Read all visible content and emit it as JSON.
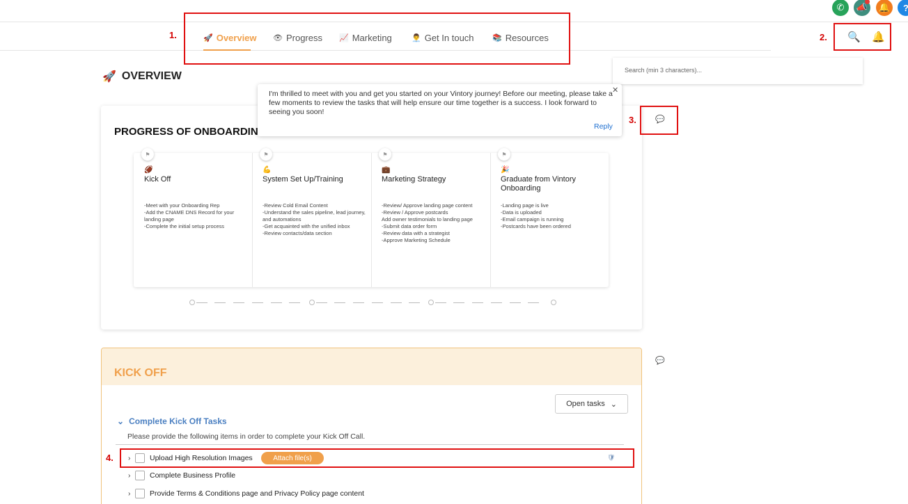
{
  "top_icons": {
    "phone": "phone-icon",
    "megaphone": "megaphone-icon",
    "bell": "bell-icon",
    "help": "?"
  },
  "nav": {
    "tabs": [
      {
        "label": "Overview",
        "icon": "🚀",
        "active": true
      },
      {
        "label": "Progress",
        "icon": "👁",
        "active": false
      },
      {
        "label": "Marketing",
        "icon": "📈",
        "active": false
      },
      {
        "label": "Get In touch",
        "icon": "👨‍💼",
        "active": false
      },
      {
        "label": "Resources",
        "icon": "📚",
        "active": false
      }
    ]
  },
  "annotations": {
    "n1": "1.",
    "n2": "2.",
    "n3": "3.",
    "n4": "4."
  },
  "header": {
    "search_icon": "🔍",
    "bell_icon": "🔔"
  },
  "search": {
    "placeholder": "Search (min 3 characters)..."
  },
  "page": {
    "title": "OVERVIEW",
    "title_icon": "🚀"
  },
  "progress_card": {
    "title": "PROGRESS OF ONBOARDIN",
    "steps": [
      {
        "emoji": "🏈",
        "title": "Kick Off",
        "desc": "-Meet with your Onboarding Rep\n-Add the CNAME DNS Record for your landing page\n-Complete the initial setup process"
      },
      {
        "emoji": "💪",
        "title": "System Set Up/Training",
        "desc": "-Review Cold Email Content\n-Understand the sales pipeline, lead journey, and automations\n-Get acquainted with the unified inbox\n-Review contacts/data section"
      },
      {
        "emoji": "💼",
        "title": "Marketing Strategy",
        "desc": "-Review/ Approve landing page content\n-Review / Approve postcards\nAdd owner testimonials to landing page\n-Submit data order form\n-Review data with a strategist\n-Approve Marketing Schedule"
      },
      {
        "emoji": "🎉",
        "title": "Graduate from Vintory Onboarding",
        "desc": "-Landing page is live\n-Data is uploaded\n-Email campaign is running\n-Postcards have been ordered"
      }
    ]
  },
  "popup": {
    "message": "I'm thrilled to meet with you and get you started on your Vintory journey! Before our meeting, please take a few moments to review the tasks that will help ensure our time together is a success. I look forward to seeing you soon!",
    "close": "✕",
    "reply": "Reply"
  },
  "kickoff": {
    "title": "KICK OFF",
    "open_tasks": "Open tasks",
    "section_title": "Complete Kick Off Tasks",
    "section_desc": "Please provide the following items in order to complete your Kick Off Call.",
    "tasks": [
      {
        "label": "Upload High Resolution Images"
      },
      {
        "label": "Complete Business Profile"
      },
      {
        "label": "Provide Terms & Conditions page and Privacy Policy page content"
      }
    ],
    "attach_label": "Attach file(s)"
  }
}
